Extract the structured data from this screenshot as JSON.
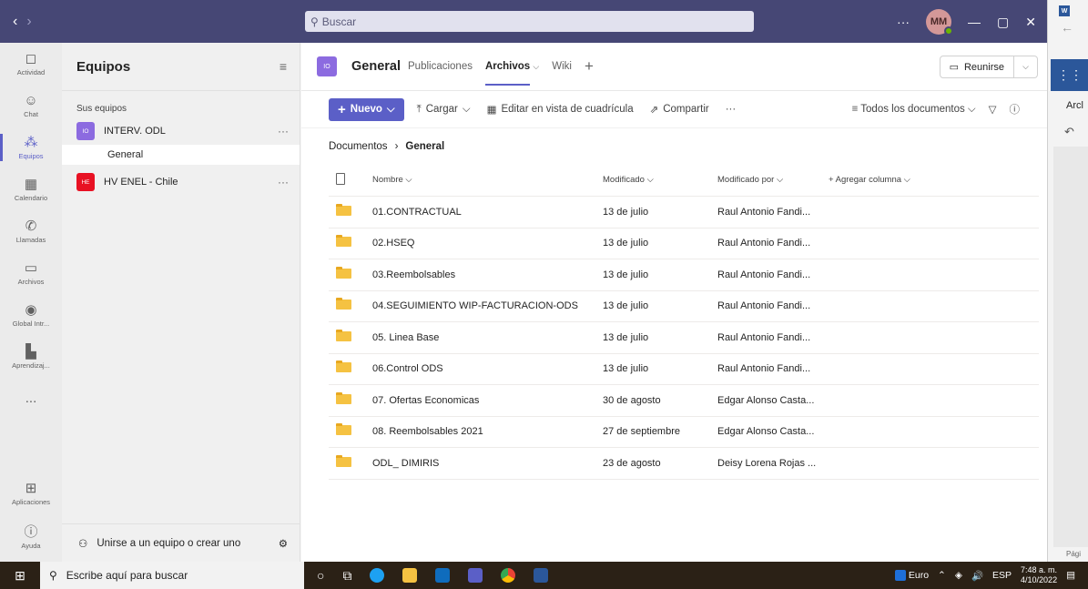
{
  "titlebar": {
    "search_placeholder": "Buscar",
    "more": "···",
    "avatar_initials": "MM"
  },
  "rail": [
    {
      "label": "Actividad",
      "icon": "bell-icon",
      "glyph": "🔔"
    },
    {
      "label": "Chat",
      "icon": "chat-icon",
      "glyph": "💬"
    },
    {
      "label": "Equipos",
      "icon": "teams-icon",
      "glyph": "👥"
    },
    {
      "label": "Calendario",
      "icon": "calendar-icon",
      "glyph": "▦"
    },
    {
      "label": "Llamadas",
      "icon": "phone-icon",
      "glyph": "✆"
    },
    {
      "label": "Archivos",
      "icon": "file-icon",
      "glyph": "🗋"
    },
    {
      "label": "Global Intr...",
      "icon": "globe-icon",
      "glyph": "◉"
    },
    {
      "label": "Aprendizaj...",
      "icon": "learning-icon",
      "glyph": "▮"
    },
    {
      "label": "...",
      "icon": "more-icon",
      "glyph": ""
    },
    {
      "label": "Aplicaciones",
      "icon": "apps-icon",
      "glyph": "⊞"
    },
    {
      "label": "Ayuda",
      "icon": "help-icon",
      "glyph": "?"
    }
  ],
  "teams_panel": {
    "title": "Equipos",
    "section_label": "Sus equipos",
    "teams": [
      {
        "initials": "IO",
        "name": "INTERV. ODL",
        "color": "#8c6be0",
        "channels": [
          "General"
        ]
      },
      {
        "initials": "HE",
        "name": "HV ENEL - Chile",
        "color": "#e81123",
        "channels": []
      }
    ],
    "footer_join": "Unirse a un equipo o crear uno"
  },
  "channel": {
    "tile": "IO",
    "title": "General",
    "tabs": [
      "Publicaciones",
      "Archivos",
      "Wiki"
    ],
    "active_tab": "Archivos",
    "meet_label": "Reunirse"
  },
  "toolbar": {
    "new": "Nuevo",
    "upload": "Cargar",
    "grid_edit": "Editar en vista de cuadrícula",
    "share": "Compartir",
    "more": "···",
    "view": "Todos los documentos"
  },
  "breadcrumb": {
    "root": "Documentos",
    "current": "General"
  },
  "table": {
    "headers": {
      "name": "Nombre",
      "modified": "Modificado",
      "modified_by": "Modificado por",
      "add_column": "+ Agregar columna"
    },
    "rows": [
      {
        "name": "01.CONTRACTUAL",
        "modified": "13 de julio",
        "by": "Raul Antonio Fandi..."
      },
      {
        "name": "02.HSEQ",
        "modified": "13 de julio",
        "by": "Raul Antonio Fandi..."
      },
      {
        "name": "03.Reembolsables",
        "modified": "13 de julio",
        "by": "Raul Antonio Fandi..."
      },
      {
        "name": "04.SEGUIMIENTO WIP-FACTURACION-ODS",
        "modified": "13 de julio",
        "by": "Raul Antonio Fandi..."
      },
      {
        "name": "05. Linea Base",
        "modified": "13 de julio",
        "by": "Raul Antonio Fandi..."
      },
      {
        "name": "06.Control ODS",
        "modified": "13 de julio",
        "by": "Raul Antonio Fandi..."
      },
      {
        "name": "07. Ofertas Economicas",
        "modified": "30 de agosto",
        "by": "Edgar Alonso Casta..."
      },
      {
        "name": "08. Reembolsables 2021",
        "modified": "27 de septiembre",
        "by": "Edgar Alonso Casta..."
      },
      {
        "name": "ODL_ DIMIRIS",
        "modified": "23 de agosto",
        "by": "Deisy Lorena Rojas ..."
      }
    ]
  },
  "side_window": {
    "badge": "W",
    "text": "Arcl",
    "page": "Pági"
  },
  "taskbar": {
    "search_placeholder": "Escribe aquí para buscar",
    "currency": "Euro",
    "lang": "ESP",
    "time": "7:48 a. m.",
    "date": "4/10/2022"
  }
}
